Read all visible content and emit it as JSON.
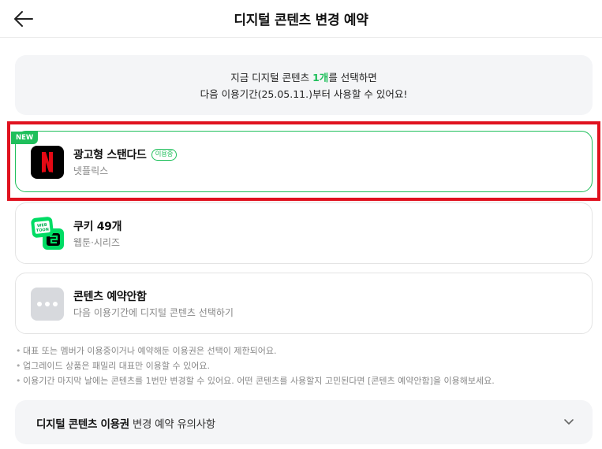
{
  "header": {
    "title": "디지털 콘텐츠 변경 예약",
    "back_icon": "arrow-left-icon"
  },
  "notice": {
    "line1_pre": "지금 디지털 콘텐츠 ",
    "line1_count": "1개",
    "line1_post": "를 선택하면",
    "line2": "다음 이용기간(25.05.11.)부터 사용할 수 있어요!"
  },
  "options": [
    {
      "tag": "NEW",
      "title": "광고형 스탠다드",
      "badge": "이용중",
      "subtitle": "넷플릭스",
      "icon": "netflix-logo-icon",
      "selected": true
    },
    {
      "title": "쿠키 49개",
      "subtitle": "웹툰·시리즈",
      "icon": "webtoon-series-icon",
      "selected": false
    },
    {
      "title": "콘텐츠 예약안함",
      "subtitle": "다음 이용기간에 디지털 콘텐츠 선택하기",
      "icon": "more-dots-icon",
      "selected": false
    }
  ],
  "notes": [
    "대표 또는 멤버가 이용중이거나 예약해둔 이용권은 선택이 제한되어요.",
    "업그레이드 상품은 패밀리 대표만 이용할 수 있어요.",
    "이용기간 마지막 날에는 콘텐츠를 1번만 변경할 수 있어요. 어떤 콘텐츠를 사용할지 고민된다면 [콘텐츠 예약안함]을 이용해보세요."
  ],
  "accordion": {
    "title_bold": "디지털 콘텐츠 이용권",
    "title_rest": " 변경 예약 유의사항",
    "icon": "chevron-down-icon"
  },
  "colors": {
    "accent": "#1fbf5b",
    "highlight_frame": "#e0121f",
    "netflix_red": "#e50914",
    "webtoon_green": "#00dc64"
  }
}
